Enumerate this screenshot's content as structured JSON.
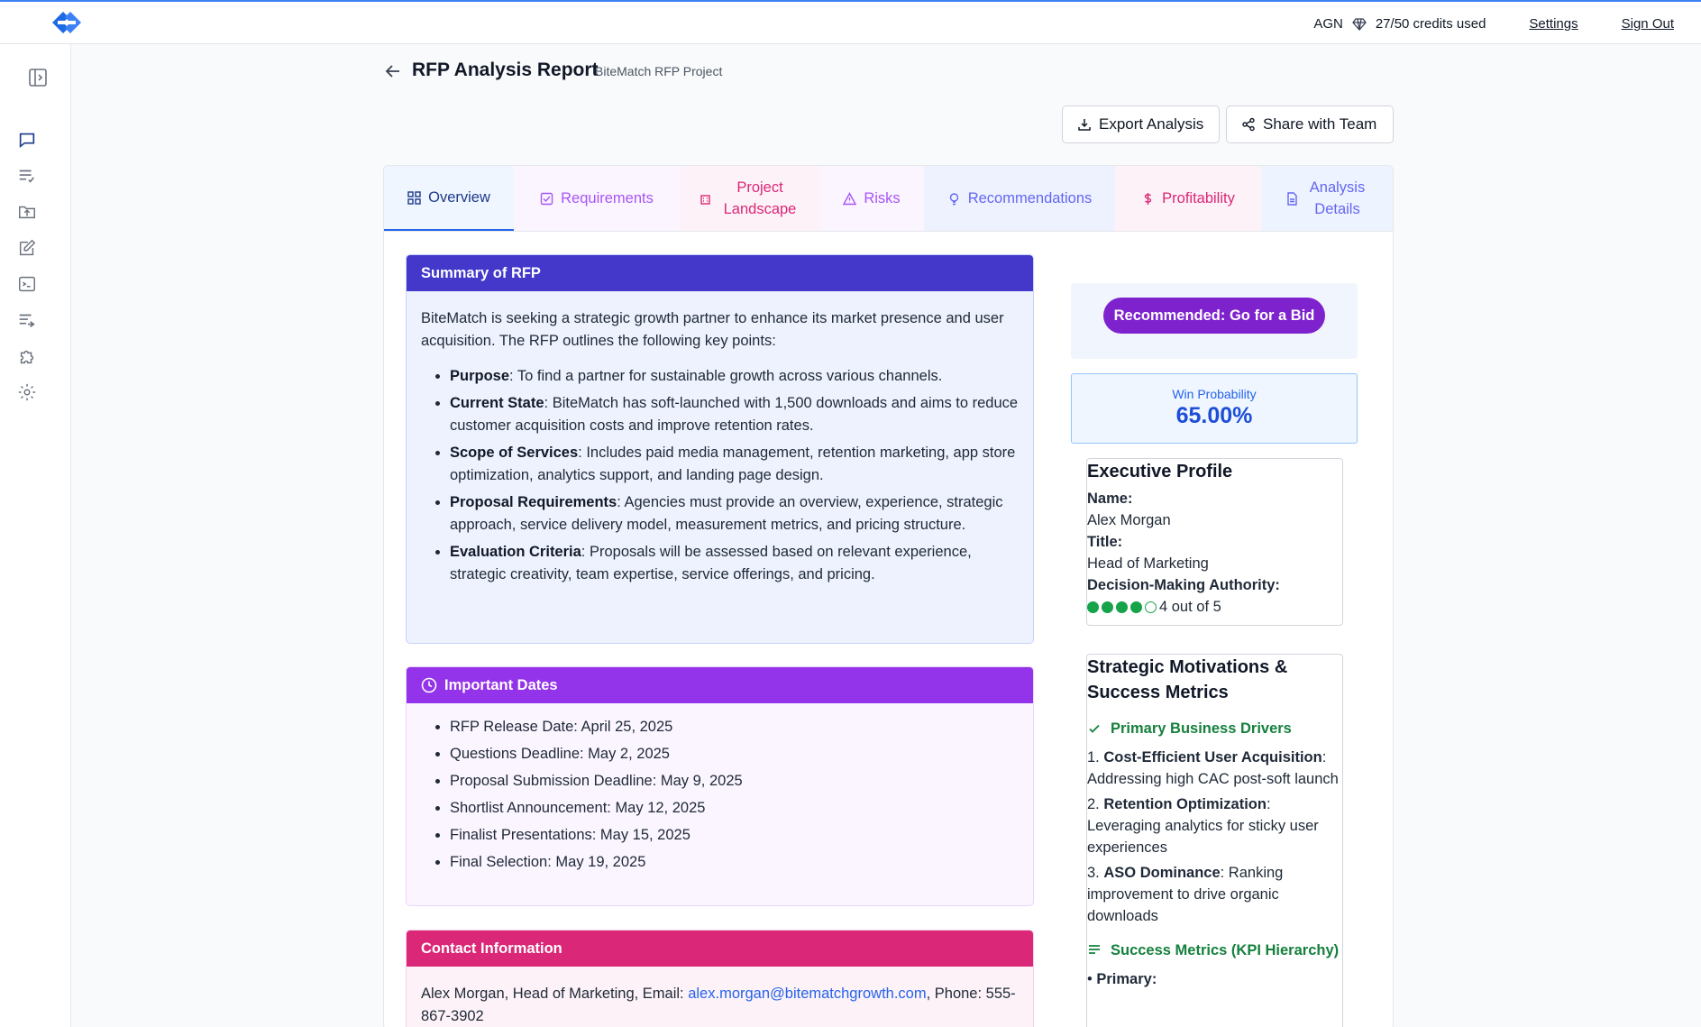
{
  "topbar": {
    "org": "AGN",
    "credits": "27/50 credits used",
    "settings_label": "Settings",
    "signout_label": "Sign Out"
  },
  "header": {
    "title": "RFP Analysis Report",
    "subtitle": "BiteMatch RFP Project",
    "export_label": "Export Analysis",
    "share_label": "Share with Team"
  },
  "tabs": [
    {
      "label": "Overview",
      "color": "#1e3a8a",
      "active": true
    },
    {
      "label": "Requirements",
      "color": "#a855f7"
    },
    {
      "label": "Project Landscape",
      "color": "#db2777"
    },
    {
      "label": "Risks",
      "color": "#a855f7"
    },
    {
      "label": "Recommendations",
      "color": "#6366f1"
    },
    {
      "label": "Profitability",
      "color": "#db2777"
    },
    {
      "label": "Analysis Details",
      "color": "#6366f1"
    }
  ],
  "summary": {
    "heading": "Summary of RFP",
    "intro": "BiteMatch is seeking a strategic growth partner to enhance its market presence and user acquisition. The RFP outlines the following key points:",
    "points": [
      {
        "term": "Purpose",
        "text": ": To find a partner for sustainable growth across various channels."
      },
      {
        "term": "Current State",
        "text": ": BiteMatch has soft-launched with 1,500 downloads and aims to reduce customer acquisition costs and improve retention rates."
      },
      {
        "term": "Scope of Services",
        "text": ": Includes paid media management, retention marketing, app store optimization, analytics support, and landing page design."
      },
      {
        "term": "Proposal Requirements",
        "text": ": Agencies must provide an overview, experience, strategic approach, service delivery model, measurement metrics, and pricing structure."
      },
      {
        "term": "Evaluation Criteria",
        "text": ": Proposals will be assessed based on relevant experience, strategic creativity, team expertise, service offerings, and pricing."
      }
    ]
  },
  "dates": {
    "heading": "Important Dates",
    "items": [
      "RFP Release Date: April 25, 2025",
      "Questions Deadline: May 2, 2025",
      "Proposal Submission Deadline: May 9, 2025",
      "Shortlist Announcement: May 12, 2025",
      "Finalist Presentations: May 15, 2025",
      "Final Selection: May 19, 2025"
    ]
  },
  "contact": {
    "heading": "Contact Information",
    "prefix": "Alex Morgan, Head of Marketing, Email: ",
    "email": "alex.morgan@bitematchgrowth.com",
    "phone_prefix": ", Phone:",
    "phone": "555-867-3902"
  },
  "recommendation": {
    "label": "Recommended: Go for a Bid"
  },
  "win": {
    "label": "Win Probability",
    "value": "65.00%"
  },
  "profile": {
    "heading": "Executive Profile",
    "name_label": "Name:",
    "name": "Alex Morgan",
    "title_label": "Title:",
    "title": "Head of Marketing",
    "authority_label": "Decision-Making Authority:",
    "authority_score": 4,
    "authority_max": 5,
    "authority_text": "4 out of 5"
  },
  "strategy": {
    "heading": "Strategic Motivations & Success Metrics",
    "drivers_heading": "Primary Business Drivers",
    "drivers": [
      {
        "num": "1. ",
        "term": "Cost-Efficient User Acquisition",
        "text": ": Addressing high CAC post-soft launch"
      },
      {
        "num": "2. ",
        "term": "Retention Optimization",
        "text": ": Leveraging analytics for sticky user experiences"
      },
      {
        "num": "3. ",
        "term": "ASO Dominance",
        "text": ": Ranking improvement to drive organic downloads"
      }
    ],
    "metrics_heading": "Success Metrics (KPI Hierarchy)",
    "primary_label": "Primary:"
  },
  "colors": {
    "summary_head": "#4338ca",
    "summary_body": "#eef2ff",
    "dates_head": "#9333ea",
    "dates_body": "#faf5ff",
    "contact_head": "#db2777",
    "contact_body": "#fdf2f8",
    "accent_blue": "#2563eb"
  }
}
